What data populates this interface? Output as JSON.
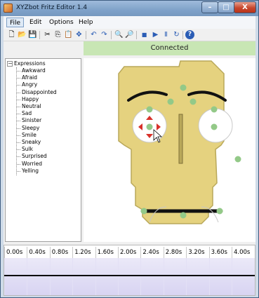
{
  "window": {
    "title": "XYZbot Fritz Editor 1.4",
    "controls": {
      "minimize": "–",
      "maximize": "□",
      "close": "X"
    }
  },
  "menu": [
    {
      "label": "File",
      "active": true
    },
    {
      "label": "Edit"
    },
    {
      "label": "Options"
    },
    {
      "label": "Help"
    }
  ],
  "toolbar": {
    "icons": [
      "new-file-icon",
      "open-folder-icon",
      "save-icon",
      "cut-icon",
      "copy-icon",
      "paste-icon",
      "move-icon",
      "undo-icon",
      "redo-icon",
      "zoom-in-icon",
      "zoom-out-icon",
      "stop-icon",
      "play-icon",
      "pause-icon",
      "loop-icon",
      "help-icon"
    ],
    "glyphs": [
      "🗋",
      "📂",
      "💾",
      "✂",
      "⎘",
      "📋",
      "✥",
      "↶",
      "↷",
      "🔍",
      "🔎",
      "■",
      "▶",
      "Ⅱ",
      "↻",
      "?"
    ]
  },
  "status": {
    "text": "Connected",
    "color": "#c8e6b4"
  },
  "tree": {
    "root": "Expressions",
    "expander": "−",
    "items": [
      "Awkward",
      "Afraid",
      "Angry",
      "Disappointed",
      "Happy",
      "Neutral",
      "Sad",
      "Sinister",
      "Sleepy",
      "Smile",
      "Sneaky",
      "Sulk",
      "Surprised",
      "Worried",
      "Yelling"
    ]
  },
  "face": {
    "colors": {
      "skin": "#e5d27f",
      "outline": "#b9a85a",
      "handle": "#93c988",
      "brow": "#111111",
      "eye": "#ffffff",
      "pupil_arrows": "#d8312a"
    }
  },
  "timeline": {
    "labels": [
      "0.00s",
      "0.40s",
      "0.80s",
      "1.20s",
      "1.60s",
      "2.00s",
      "2.40s",
      "2.80s",
      "3.20s",
      "3.60s",
      "4.00s"
    ],
    "track_color": "#d8d4f2"
  }
}
